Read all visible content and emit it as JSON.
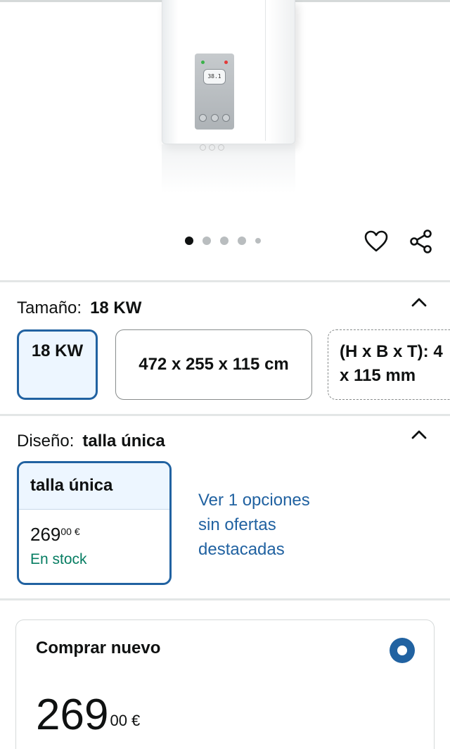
{
  "carousel": {
    "total": 5,
    "active_index": 0
  },
  "heater_display": "38.1",
  "size": {
    "label": "Tamaño:",
    "selected": "18 KW",
    "options": [
      "18 KW",
      "472 x 255 x 115 cm",
      "(H x B x T): 4",
      "x 115 mm"
    ]
  },
  "design": {
    "label": "Diseño:",
    "selected": "talla única",
    "card_title": "talla única",
    "price_whole": "269",
    "price_fraction": "00 €",
    "stock": "En stock",
    "link_line1": "Ver 1 opciones",
    "link_line2": "sin ofertas",
    "link_line3": "destacadas"
  },
  "buy": {
    "title": "Comprar nuevo",
    "price_whole": "269",
    "price_fraction": "00 €"
  },
  "colors": {
    "accent_blue": "#2162a1",
    "selected_bg": "#edf6ff",
    "stock_green": "#067d62"
  }
}
